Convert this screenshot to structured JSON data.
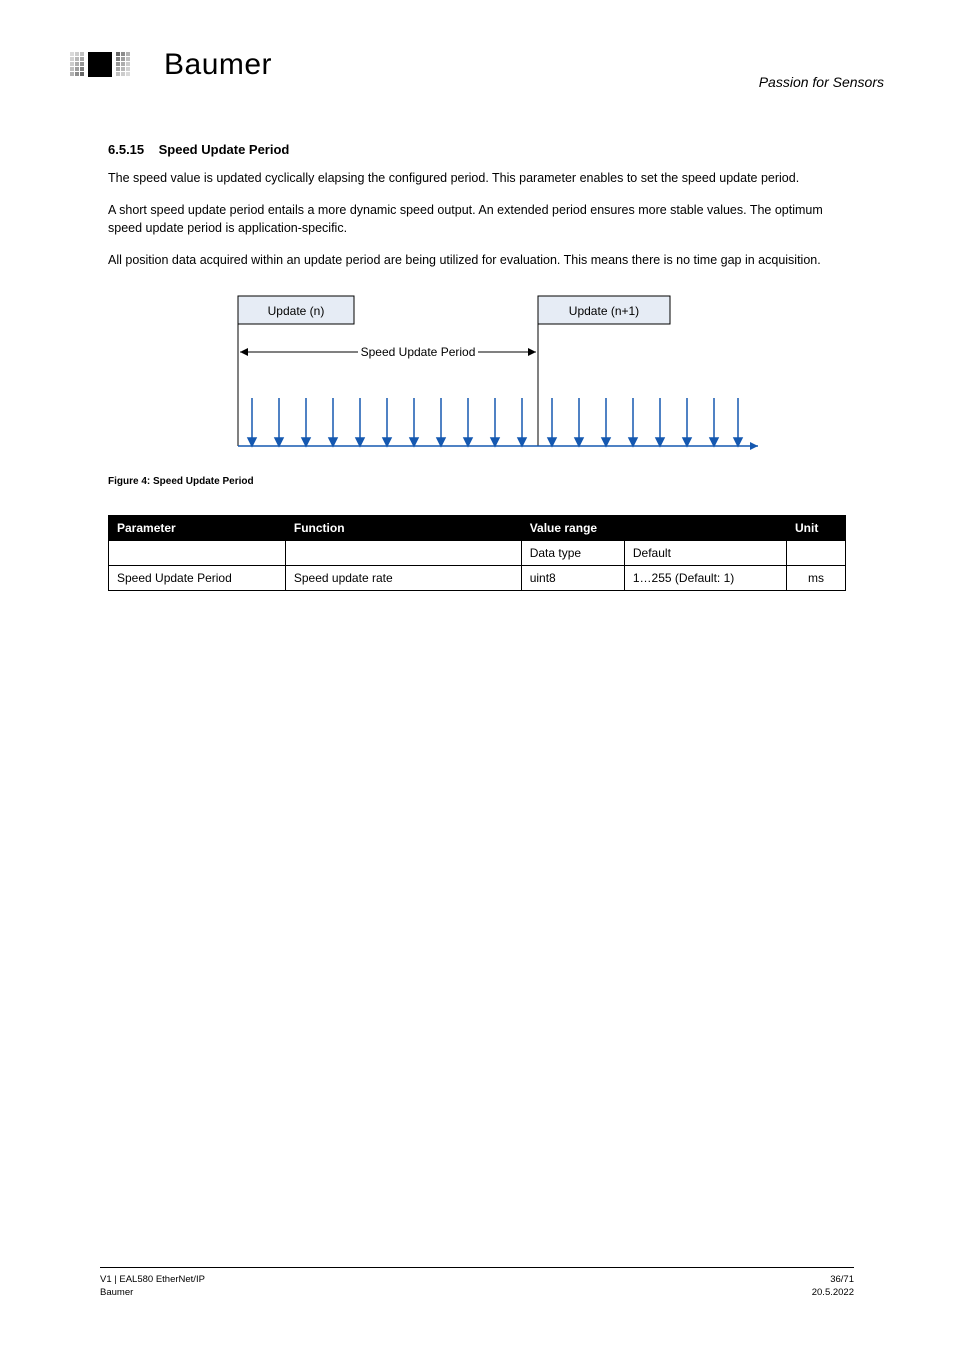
{
  "header": {
    "brand": "Baumer",
    "tagline": "Passion for Sensors"
  },
  "section": {
    "number": "6.5.15",
    "title": "Speed Update Period"
  },
  "paragraphs": {
    "p1": "The speed value is updated cyclically elapsing the configured period. This parameter enables to set the speed update period.",
    "p2": "A short speed update period entails a more dynamic speed output. An extended period ensures more stable values. The optimum speed update period is application-specific.",
    "p3": "All position data acquired within an update period are being utilized for evaluation. This means there is no time gap in acquisition."
  },
  "figure": {
    "labels": {
      "update_n": "Update (n)",
      "update_n1": "Update (n+1)",
      "period": "Speed Update Period"
    },
    "caption": "Figure 4: Speed Update Period"
  },
  "table": {
    "headers": {
      "parameter": "Parameter",
      "function": "Function",
      "value_range": "Value range",
      "unit": "Unit"
    },
    "subheaders": {
      "data_type": "Data type",
      "default": "Default"
    },
    "row": {
      "parameter": "Speed Update Period",
      "function": "Speed update rate",
      "data_type": "uint8",
      "default": "1…255 (Default: 1)",
      "unit": "ms"
    }
  },
  "footer": {
    "doc": "V1 | EAL580 EtherNet/IP",
    "company": "Baumer",
    "page": "36/71",
    "date": "20.5.2022"
  }
}
